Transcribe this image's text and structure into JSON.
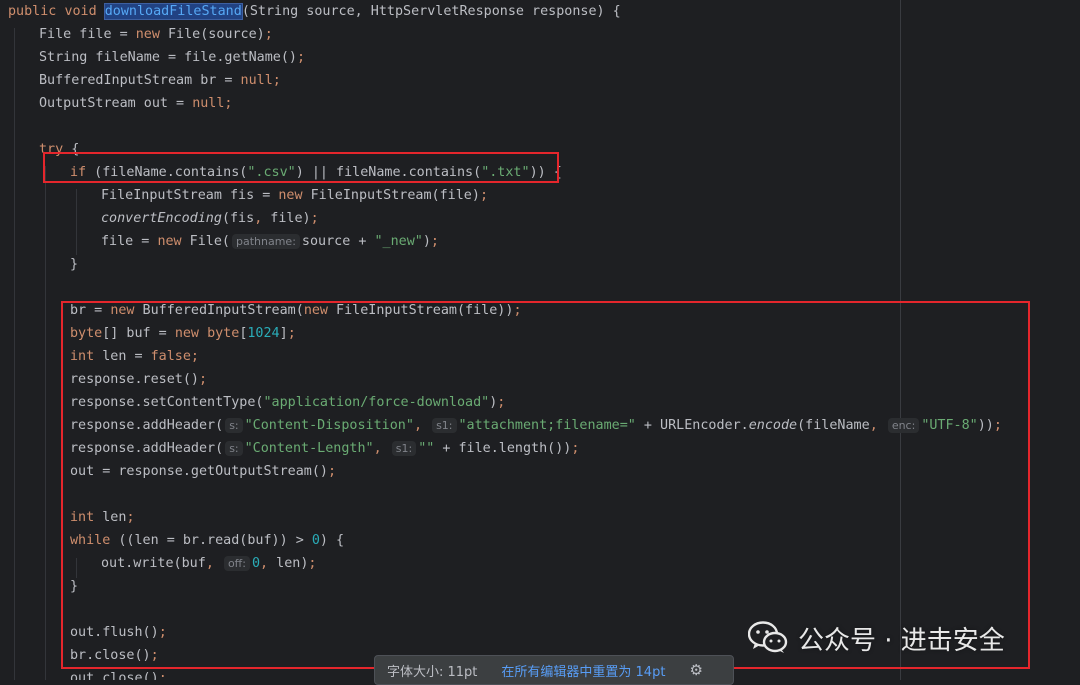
{
  "code_lines": [
    [
      {
        "t": "public",
        "c": "kw"
      },
      {
        "t": " ",
        "c": "id"
      },
      {
        "t": "void",
        "c": "kw"
      },
      {
        "t": " ",
        "c": "id"
      },
      {
        "t": "downloadFileStand",
        "c": "hl"
      },
      {
        "t": "(String source, HttpServletResponse response) {",
        "c": "id"
      }
    ],
    [
      {
        "t": "File file = ",
        "c": "id"
      },
      {
        "t": "new",
        "c": "kw"
      },
      {
        "t": " File(source)",
        "c": "id"
      },
      {
        "t": ";",
        "c": "kw"
      }
    ],
    [
      {
        "t": "String fileName = file.getName()",
        "c": "id"
      },
      {
        "t": ";",
        "c": "kw"
      }
    ],
    [
      {
        "t": "BufferedInputStream br = ",
        "c": "id"
      },
      {
        "t": "null;",
        "c": "kw"
      }
    ],
    [
      {
        "t": "OutputStream out = ",
        "c": "id"
      },
      {
        "t": "null;",
        "c": "kw"
      }
    ],
    [],
    [
      {
        "t": "try",
        "c": "kw"
      },
      {
        "t": " {",
        "c": "id"
      }
    ],
    [
      {
        "t": "if",
        "c": "kw"
      },
      {
        "t": " (fileName.contains(",
        "c": "id"
      },
      {
        "t": "\".csv\"",
        "c": "str"
      },
      {
        "t": ") || fileName.contains(",
        "c": "id"
      },
      {
        "t": "\".txt\"",
        "c": "str"
      },
      {
        "t": ")) {",
        "c": "id"
      }
    ],
    [
      {
        "t": "FileInputStream fis = ",
        "c": "id"
      },
      {
        "t": "new",
        "c": "kw"
      },
      {
        "t": " FileInputStream(file)",
        "c": "id"
      },
      {
        "t": ";",
        "c": "kw"
      }
    ],
    [
      {
        "t": "convertEncoding",
        "c": "italic"
      },
      {
        "t": "(fis",
        "c": "id"
      },
      {
        "t": ",",
        "c": "kw"
      },
      {
        "t": " file)",
        "c": "id"
      },
      {
        "t": ";",
        "c": "kw"
      }
    ],
    [
      {
        "t": "file = ",
        "c": "id"
      },
      {
        "t": "new",
        "c": "kw"
      },
      {
        "t": " File(",
        "c": "id"
      },
      {
        "t": "pathname:",
        "c": "hint"
      },
      {
        "t": "source + ",
        "c": "id"
      },
      {
        "t": "\"_new\"",
        "c": "str"
      },
      {
        "t": ")",
        "c": "id"
      },
      {
        "t": ";",
        "c": "kw"
      }
    ],
    [
      {
        "t": "}",
        "c": "id"
      }
    ],
    [],
    [
      {
        "t": "br = ",
        "c": "id"
      },
      {
        "t": "new",
        "c": "kw"
      },
      {
        "t": " BufferedInputStream(",
        "c": "id"
      },
      {
        "t": "new",
        "c": "kw"
      },
      {
        "t": " FileInputStream(file))",
        "c": "id"
      },
      {
        "t": ";",
        "c": "kw"
      }
    ],
    [
      {
        "t": "byte",
        "c": "kw"
      },
      {
        "t": "[] buf = ",
        "c": "id"
      },
      {
        "t": "new",
        "c": "kw"
      },
      {
        "t": " ",
        "c": "id"
      },
      {
        "t": "byte",
        "c": "kw"
      },
      {
        "t": "[",
        "c": "id"
      },
      {
        "t": "1024",
        "c": "num"
      },
      {
        "t": "]",
        "c": "id"
      },
      {
        "t": ";",
        "c": "kw"
      }
    ],
    [
      {
        "t": "int",
        "c": "kw"
      },
      {
        "t": " len = ",
        "c": "id"
      },
      {
        "t": "false;",
        "c": "kw"
      }
    ],
    [
      {
        "t": "response.reset()",
        "c": "id"
      },
      {
        "t": ";",
        "c": "kw"
      }
    ],
    [
      {
        "t": "response.setContentType(",
        "c": "id"
      },
      {
        "t": "\"application/force-download\"",
        "c": "str"
      },
      {
        "t": ")",
        "c": "id"
      },
      {
        "t": ";",
        "c": "kw"
      }
    ],
    [
      {
        "t": "response.addHeader(",
        "c": "id"
      },
      {
        "t": "s:",
        "c": "hint"
      },
      {
        "t": "\"Content-Disposition\"",
        "c": "str"
      },
      {
        "t": ", ",
        "c": "kw"
      },
      {
        "t": "s1:",
        "c": "hint"
      },
      {
        "t": "\"attachment;filename=\"",
        "c": "str"
      },
      {
        "t": " + URLEncoder.",
        "c": "id"
      },
      {
        "t": "encode",
        "c": "italic"
      },
      {
        "t": "(fileName",
        "c": "id"
      },
      {
        "t": ", ",
        "c": "kw"
      },
      {
        "t": "enc:",
        "c": "hint"
      },
      {
        "t": "\"UTF-8\"",
        "c": "str"
      },
      {
        "t": "))",
        "c": "id"
      },
      {
        "t": ";",
        "c": "kw"
      }
    ],
    [
      {
        "t": "response.addHeader(",
        "c": "id"
      },
      {
        "t": "s:",
        "c": "hint"
      },
      {
        "t": "\"Content-Length\"",
        "c": "str"
      },
      {
        "t": ", ",
        "c": "kw"
      },
      {
        "t": "s1:",
        "c": "hint"
      },
      {
        "t": "\"\"",
        "c": "str"
      },
      {
        "t": " + file.length())",
        "c": "id"
      },
      {
        "t": ";",
        "c": "kw"
      }
    ],
    [
      {
        "t": "out = response.getOutputStream()",
        "c": "id"
      },
      {
        "t": ";",
        "c": "kw"
      }
    ],
    [],
    [
      {
        "t": "int",
        "c": "kw"
      },
      {
        "t": " len",
        "c": "id"
      },
      {
        "t": ";",
        "c": "kw"
      }
    ],
    [
      {
        "t": "while",
        "c": "kw"
      },
      {
        "t": " ((len = br.read(buf)) > ",
        "c": "id"
      },
      {
        "t": "0",
        "c": "num"
      },
      {
        "t": ") {",
        "c": "id"
      }
    ],
    [
      {
        "t": "out.write(buf",
        "c": "id"
      },
      {
        "t": ", ",
        "c": "kw"
      },
      {
        "t": "off:",
        "c": "hint"
      },
      {
        "t": "0",
        "c": "num"
      },
      {
        "t": ", ",
        "c": "kw"
      },
      {
        "t": "len)",
        "c": "id"
      },
      {
        "t": ";",
        "c": "kw"
      }
    ],
    [
      {
        "t": "}",
        "c": "id"
      }
    ],
    [],
    [
      {
        "t": "out.flush()",
        "c": "id"
      },
      {
        "t": ";",
        "c": "kw"
      }
    ],
    [
      {
        "t": "br.close()",
        "c": "id"
      },
      {
        "t": ";",
        "c": "kw"
      }
    ],
    [
      {
        "t": "out.close()",
        "c": "id"
      },
      {
        "t": ";",
        "c": "kw"
      }
    ]
  ],
  "watermark": {
    "text": "公众号 · 进击安全",
    "icon": "wechat-icon"
  },
  "font_popup": {
    "size_label": "字体大小: 11pt",
    "reset_link": "在所有编辑器中重置为 14pt",
    "icon": "gear-icon"
  },
  "colors": {
    "background": "#1e1f22",
    "keyword": "#cf8e6d",
    "string": "#6aab73",
    "number": "#2aacb8",
    "method": "#56a8f5",
    "highlight_box": "#e5262c"
  }
}
